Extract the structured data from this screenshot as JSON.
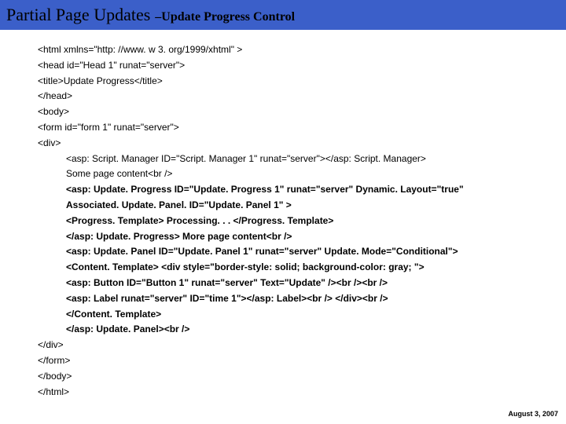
{
  "header": {
    "title_main": "Partial Page Updates",
    "title_sep": "–",
    "title_sub": "Update Progress Control"
  },
  "code": {
    "l1": "<html xmlns=\"http: //www. w 3. org/1999/xhtml\" >",
    "l2": "<head id=\"Head 1\" runat=\"server\">",
    "l3": "<title>Update Progress</title>",
    "l4": "</head>",
    "l5": "<body>",
    "l6": "<form id=\"form 1\" runat=\"server\">",
    "l7": "<div>",
    "l8": "<asp: Script. Manager ID=\"Script. Manager 1\" runat=\"server\"></asp: Script. Manager>",
    "l9": "Some page content<br />",
    "l10": "<asp: Update. Progress ID=\"Update. Progress 1\" runat=\"server\" Dynamic. Layout=\"true\"",
    "l11": "Associated. Update. Panel. ID=\"Update. Panel 1\" >",
    "l12": "<Progress. Template> Processing. . . </Progress. Template>",
    "l13": "</asp: Update. Progress> More page content<br />",
    "l14": "<asp: Update. Panel ID=\"Update. Panel 1\" runat=\"server\" Update. Mode=\"Conditional\">",
    "l15": "<Content. Template> <div style=\"border-style: solid; background-color: gray; \">",
    "l16": "<asp: Button ID=\"Button 1\" runat=\"server\" Text=\"Update\" /><br /><br />",
    "l17": "<asp: Label runat=\"server\" ID=\"time 1\"></asp: Label><br /> </div><br />",
    "l18": "</Content. Template>",
    "l19": "</asp: Update. Panel><br />",
    "l20": "</div>",
    "l21": "</form>",
    "l22": "</body>",
    "l23": "</html>"
  },
  "footer": {
    "date": "August 3, 2007"
  }
}
